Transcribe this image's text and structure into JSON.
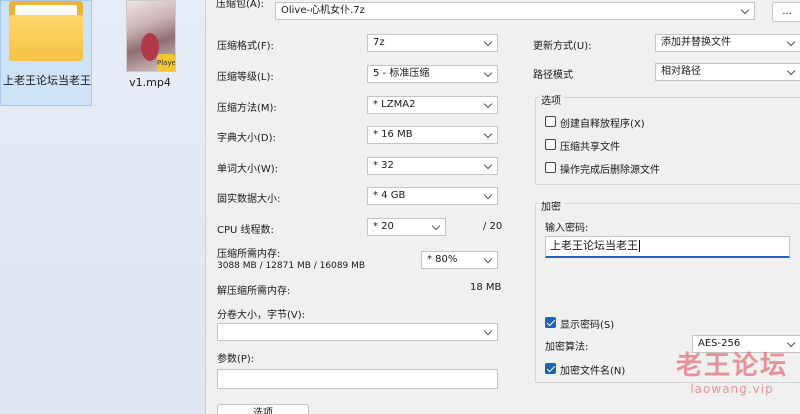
{
  "desktop": {
    "folder_label": "上老王论坛当老王",
    "video_label": "v1.mp4",
    "video_badge": "Player"
  },
  "archive": {
    "label": "压缩包(A):",
    "value": "Olive-心机女仆.7z",
    "browse_label": "..."
  },
  "left": {
    "format": {
      "label": "压缩格式(F):",
      "value": "7z"
    },
    "level": {
      "label": "压缩等级(L):",
      "value": "5 - 标准压缩"
    },
    "method": {
      "label": "压缩方法(M):",
      "value": "* LZMA2"
    },
    "dict": {
      "label": "字典大小(D):",
      "value": "* 16 MB"
    },
    "word": {
      "label": "单词大小(W):",
      "value": "* 32"
    },
    "solid": {
      "label": "固实数据大小:",
      "value": "* 4 GB"
    },
    "threads": {
      "label": "CPU 线程数:",
      "value": "* 20",
      "max": "/ 20"
    },
    "mem_compress": {
      "label": "压缩所需内存:",
      "detail": "3088 MB / 12871 MB / 16089 MB",
      "value": "* 80%"
    },
    "mem_decompress": {
      "label": "解压缩所需内存:",
      "value": "18 MB"
    },
    "split": {
      "label": "分卷大小，字节(V):",
      "value": ""
    },
    "params": {
      "label": "参数(P):",
      "value": ""
    },
    "options_button": "选项"
  },
  "right": {
    "update": {
      "label": "更新方式(U):",
      "value": "添加并替换文件"
    },
    "path": {
      "label": "路径模式",
      "value": "相对路径"
    },
    "options_group": "选项",
    "options": [
      {
        "label": "创建自释放程序(X)",
        "checked": false
      },
      {
        "label": "压缩共享文件",
        "checked": false
      },
      {
        "label": "操作完成后删除源文件",
        "checked": false
      }
    ],
    "encrypt_group": "加密",
    "password_label": "输入密码:",
    "password_value": "上老王论坛当老王",
    "show_password": {
      "label": "显示密码(S)",
      "checked": true
    },
    "method": {
      "label": "加密算法:",
      "value": "AES-256"
    },
    "encrypt_names": {
      "label": "加密文件名(N)",
      "checked": true
    }
  },
  "watermark": {
    "main": "老王论坛",
    "sub": "laowang.vip"
  }
}
